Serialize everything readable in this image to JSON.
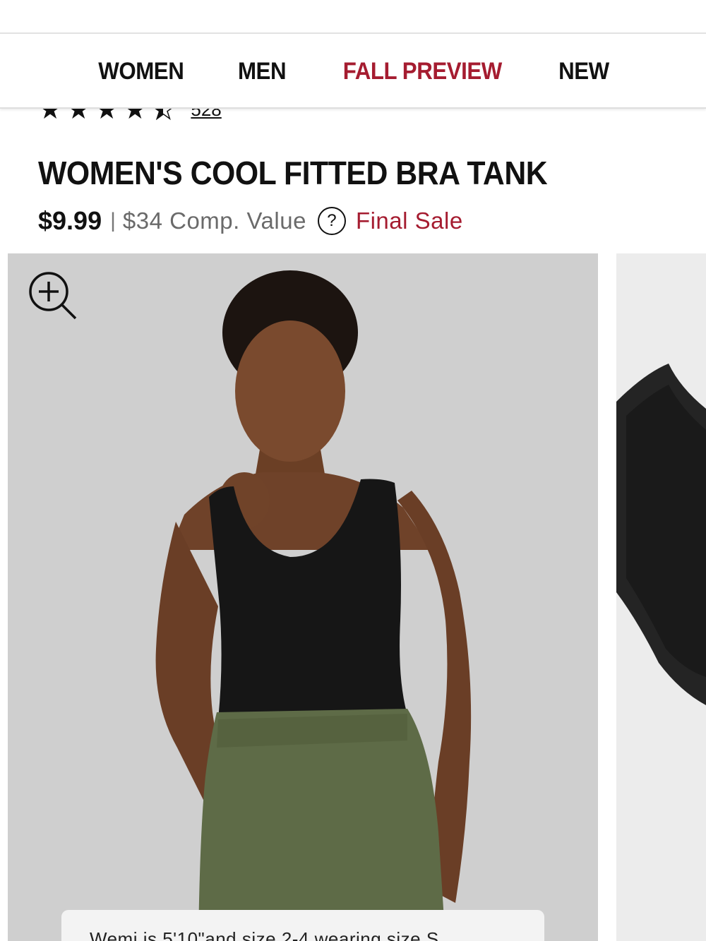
{
  "nav": {
    "items": [
      {
        "label": "WOMEN",
        "accent": false
      },
      {
        "label": "MEN",
        "accent": false
      },
      {
        "label": "FALL PREVIEW",
        "accent": true
      },
      {
        "label": "NEW",
        "accent": false
      }
    ]
  },
  "product": {
    "rating": {
      "value": 4.5,
      "max": 5,
      "review_count": "528"
    },
    "title": "WOMEN'S COOL FITTED BRA TANK",
    "price": "$9.99",
    "divider": "|",
    "comp_value": "$34 Comp. Value",
    "help_glyph": "?",
    "final_sale": "Final Sale"
  },
  "gallery": {
    "caption": "Wemi is 5'10\"and size 2-4 wearing size S",
    "zoom_icon": "zoom-in-icon"
  },
  "colors": {
    "accent": "#a51c30",
    "image_bg": "#cfcfcf",
    "tank": "#161616",
    "pants": "#5e6b47",
    "skin": "#7a4a2e"
  }
}
